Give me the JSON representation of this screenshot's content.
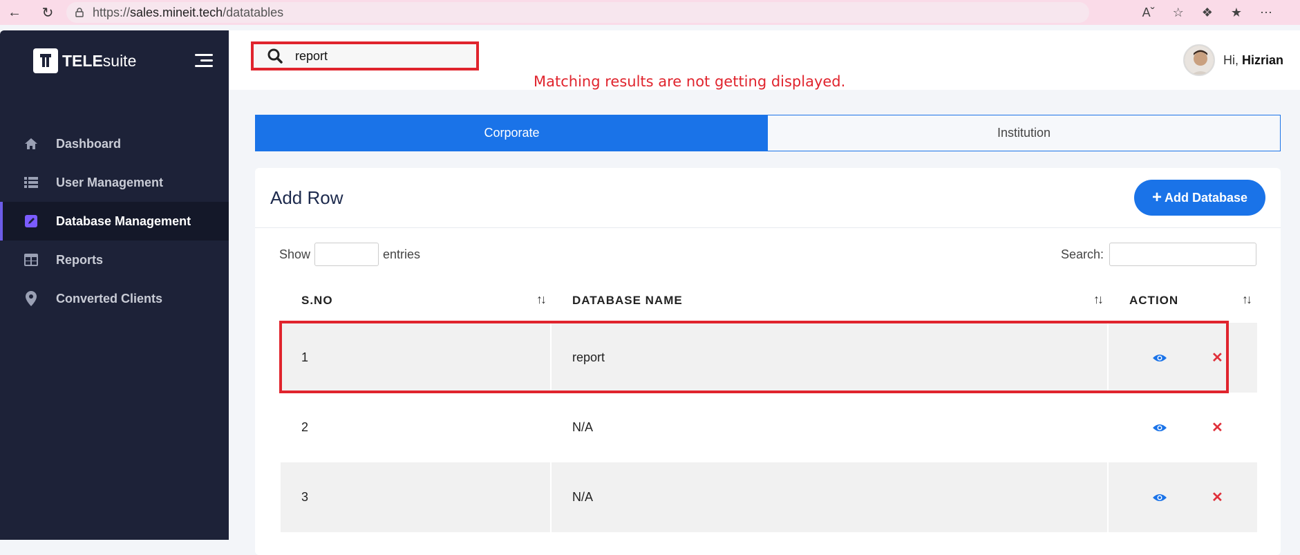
{
  "browser": {
    "url_scheme": "https://",
    "url_host": "sales.mineit.tech",
    "url_path": "/datatables"
  },
  "brand": {
    "bold": "TELE",
    "light": "suite"
  },
  "sidebar": {
    "items": [
      {
        "label": "Dashboard",
        "icon": "home-icon",
        "active": false
      },
      {
        "label": "User Management",
        "icon": "list-icon",
        "active": false
      },
      {
        "label": "Database Management",
        "icon": "edit-icon",
        "active": true
      },
      {
        "label": "Reports",
        "icon": "table-icon",
        "active": false
      },
      {
        "label": "Converted Clients",
        "icon": "map-pin-icon",
        "active": false
      }
    ]
  },
  "header": {
    "search_value": "report",
    "greeting": "Hi,",
    "username": "Hizrian"
  },
  "annotation": "Matching results are not getting displayed.",
  "tabs": [
    {
      "label": "Corporate",
      "active": true
    },
    {
      "label": "Institution",
      "active": false
    }
  ],
  "card": {
    "title": "Add Row",
    "add_button": "Add Database",
    "show_label": "Show",
    "entries_label": "entries",
    "search_label": "Search:"
  },
  "table": {
    "columns": [
      "S.NO",
      "DATABASE NAME",
      "ACTION"
    ],
    "rows": [
      {
        "sno": "1",
        "name": "report"
      },
      {
        "sno": "2",
        "name": "N/A"
      },
      {
        "sno": "3",
        "name": "N/A"
      }
    ]
  },
  "colors": {
    "accent": "#1a73e8",
    "sidebar": "#1d2238",
    "annotation": "#e0242d"
  }
}
